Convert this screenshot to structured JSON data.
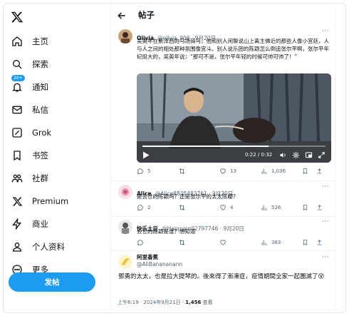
{
  "nav": {
    "items": [
      {
        "label": "主页",
        "icon": "home-icon"
      },
      {
        "label": "探索",
        "icon": "search-icon"
      },
      {
        "label": "通知",
        "icon": "bell-icon",
        "badge": "20+"
      },
      {
        "label": "私信",
        "icon": "mail-icon"
      },
      {
        "label": "Grok",
        "icon": "grok-icon"
      },
      {
        "label": "书签",
        "icon": "bookmark-icon"
      },
      {
        "label": "社群",
        "icon": "communities-icon"
      },
      {
        "label": "Premium",
        "icon": "x-icon"
      },
      {
        "label": "商业",
        "icon": "lightning-icon"
      },
      {
        "label": "个人资料",
        "icon": "person-icon"
      },
      {
        "label": "更多",
        "icon": "more-circle-icon"
      }
    ],
    "post_button": "发帖"
  },
  "header": {
    "title": "帖子"
  },
  "post": {
    "name": "Olivia",
    "handle": "@olivia_906 · 9月20日",
    "text": "吴英年在新泽西的马场骑马，他和别人闲聊说山上离主佛近的那些人像小宫廷，人与人之间的相处那种氛围像宫斗。别人说乐团的陈颖怎么倒追张尔平啊，张尔平年纪挺大的，吴英年说：“那可不是，张尔平年轻的时候可帅可帅了！”",
    "video": {
      "time": "0:22 / 0:32",
      "progress": 0.69
    },
    "stats": {
      "replies": "5",
      "reposts": "",
      "likes": "13",
      "views": "1,036"
    }
  },
  "replies": [
    {
      "name": "Alice",
      "handle": "@Alice8835483761 · 9月20日",
      "text": "是去世的陈颖吗？还是张尔平的太太陈纓?",
      "stats": {
        "replies": "2",
        "reposts": "",
        "likes": "4",
        "views": "526"
      }
    },
    {
      "name": "快乐土豆",
      "handle": "@Happypo02797746 · 9月20日",
      "text": "去世的陈颖是谁？想知道",
      "stats": {
        "replies": "",
        "reposts": "",
        "likes": "",
        "views": "383"
      }
    }
  ],
  "main_reply": {
    "name": "阿里香蕉",
    "handle": "@AliBanananann",
    "text": "鄧勇的太太，也是拉大提琴的。後來得了漸凍症，疫情期間全家一起團滅了😵",
    "timestamp": "上午6:19 · 2024年9月21日 · ",
    "views_count": "1,456",
    "views_label": " 查看"
  }
}
